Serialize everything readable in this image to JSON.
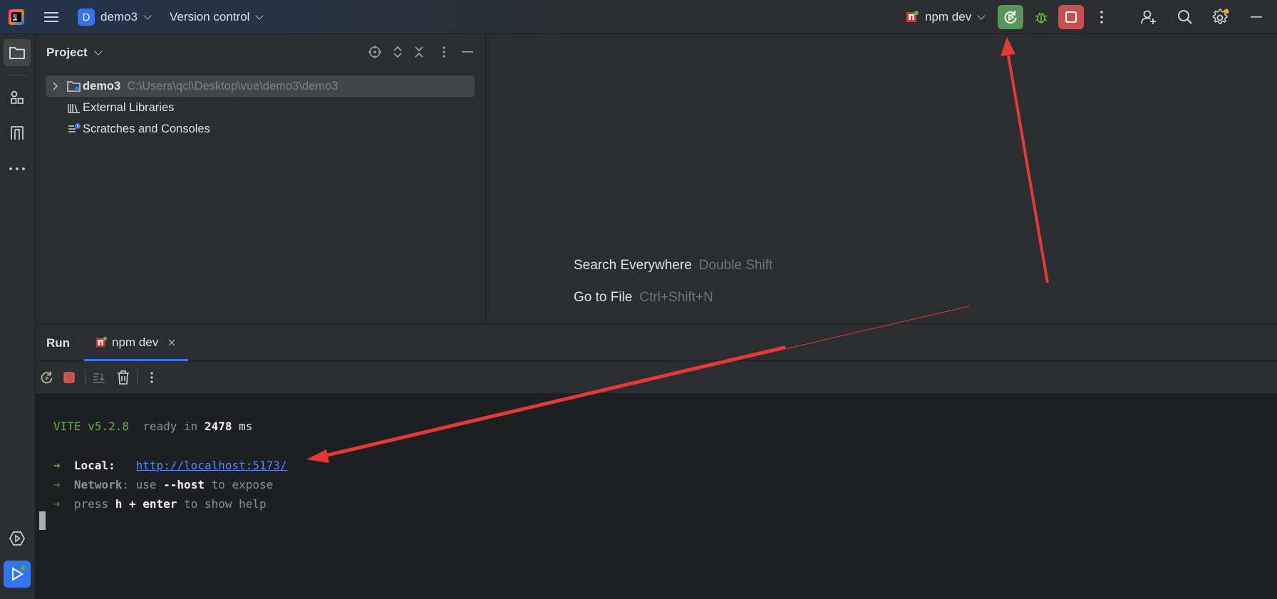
{
  "titlebar": {
    "project_badge": "D",
    "project_name": "demo3",
    "vcs_label": "Version control",
    "run_config": "npm dev"
  },
  "project_panel": {
    "title": "Project",
    "tree": [
      {
        "label": "demo3",
        "path": "C:\\Users\\qcl\\Desktop\\vue\\demo3\\demo3"
      },
      {
        "label": "External Libraries"
      },
      {
        "label": "Scratches and Consoles"
      }
    ]
  },
  "editor": {
    "hints": [
      {
        "action": "Search Everywhere",
        "shortcut": "Double Shift"
      },
      {
        "action": "Go to File",
        "shortcut": "Ctrl+Shift+N"
      }
    ]
  },
  "run": {
    "title": "Run",
    "tab_label": "npm dev",
    "console": {
      "vite_name": "VITE",
      "vite_version": "v5.2.8",
      "ready_text": "ready in",
      "ready_ms": "2478",
      "ms_unit": "ms",
      "arrow": "➜",
      "local_label": "Local:",
      "local_url": "http://localhost:5173/",
      "network_label": "Network",
      "network_use": ": use",
      "network_flag": "--host",
      "network_tail": "to expose",
      "press_text": "press",
      "press_keys": "h + enter",
      "press_tail": "to show help"
    }
  },
  "colors": {
    "accent_blue": "#3574f0",
    "run_green": "#57965c",
    "stop_red": "#c94f4f",
    "annotation_red": "#e53935"
  }
}
